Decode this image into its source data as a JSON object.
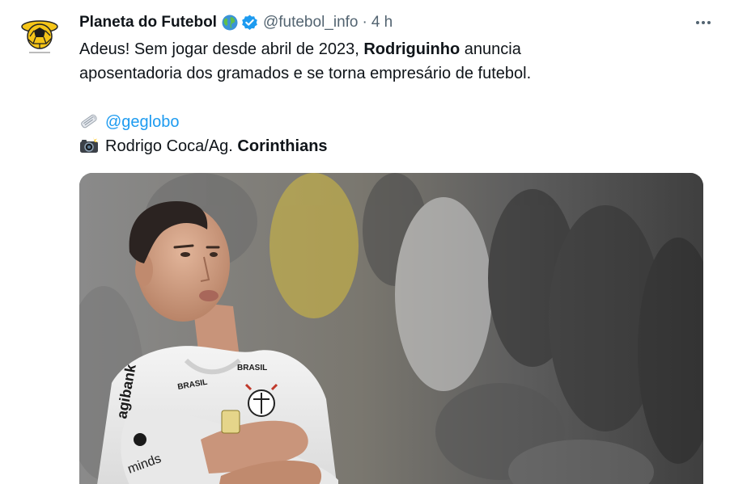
{
  "tweet": {
    "author_name": "Planeta do Futebol",
    "handle": "@futebol_info",
    "separator": "·",
    "time": "4 h",
    "text_start": "Adeus! Sem jogar desde abril de 2023, ",
    "text_bold": "Rodriguinho",
    "text_end_line1": " anuncia",
    "text_line2": "aposentadoria dos gramados e se torna empresário de futebol.",
    "source_link": "@geglobo",
    "photo_credit_start": "Rodrigo Coca/Ag. ",
    "photo_credit_bold": "Corinthians",
    "colors": {
      "link": "#1d9bf0",
      "verified": "#1d9bf0",
      "secondary_text": "#536471"
    },
    "icons": [
      "globe-icon",
      "verified-badge-icon",
      "more-options-icon",
      "newspaper-icon",
      "camera-flash-icon"
    ]
  },
  "media": {
    "jersey_texts": [
      "agibank",
      "minds",
      "BRASIL",
      "BRASIL"
    ]
  }
}
